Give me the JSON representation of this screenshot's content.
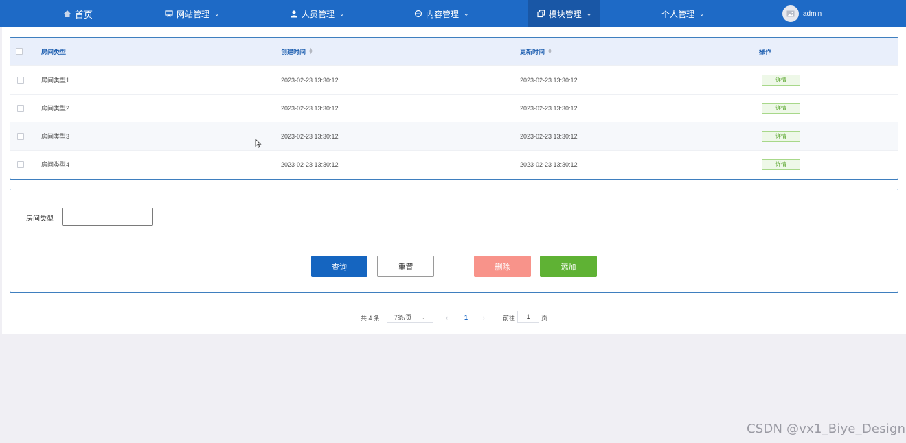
{
  "nav": {
    "home": "首页",
    "site": "网站管理",
    "staff": "人员管理",
    "content": "内容管理",
    "module": "模块管理",
    "personal": "个人管理",
    "user": "admin"
  },
  "table": {
    "headers": {
      "type": "房间类型",
      "created": "创建时间",
      "updated": "更新时间",
      "ops": "操作"
    },
    "rows": [
      {
        "type": "房间类型1",
        "created": "2023-02-23 13:30:12",
        "updated": "2023-02-23 13:30:12",
        "action": "详情"
      },
      {
        "type": "房间类型2",
        "created": "2023-02-23 13:30:12",
        "updated": "2023-02-23 13:30:12",
        "action": "详情"
      },
      {
        "type": "房间类型3",
        "created": "2023-02-23 13:30:12",
        "updated": "2023-02-23 13:30:12",
        "action": "详情"
      },
      {
        "type": "房间类型4",
        "created": "2023-02-23 13:30:12",
        "updated": "2023-02-23 13:30:12",
        "action": "详情"
      }
    ]
  },
  "search": {
    "label": "房间类型",
    "value": "",
    "query_btn": "查询",
    "reset_btn": "重置",
    "delete_btn": "删除",
    "add_btn": "添加"
  },
  "pagination": {
    "total": "共 4 条",
    "page_size": "7条/页",
    "current_page": "1",
    "goto_label": "前往",
    "goto_value": "1",
    "page_unit": "页"
  },
  "watermark": "CSDN @vx1_Biye_Design",
  "colors": {
    "nav_bg": "#1e6ac6",
    "nav_active": "#1957a6",
    "query": "#1565c0",
    "delete": "#f8938a",
    "add": "#5fb234"
  }
}
